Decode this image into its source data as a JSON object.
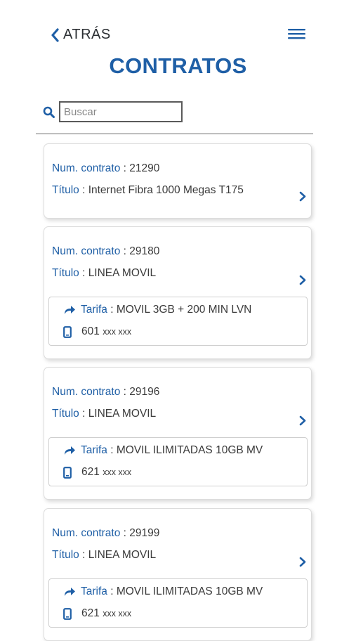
{
  "header": {
    "back_label": "ATRÁS",
    "title": "CONTRATOS"
  },
  "search": {
    "placeholder": "Buscar",
    "value": ""
  },
  "labels": {
    "contract_number": "Num. contrato",
    "title": "Título",
    "tariff": "Tarifa"
  },
  "contracts": [
    {
      "number": "21290",
      "title": "Internet Fibra 1000 Megas T175"
    },
    {
      "number": "29180",
      "title": "LINEA MOVIL",
      "tariff": "MOVIL 3GB + 200 MIN LVN",
      "phone_prefix": "601",
      "phone_masked": "xxx xxx"
    },
    {
      "number": "29196",
      "title": "LINEA MOVIL",
      "tariff": "MOVIL ILIMITADAS 10GB MV",
      "phone_prefix": "621",
      "phone_masked": "xxx xxx"
    },
    {
      "number": "29199",
      "title": "LINEA MOVIL",
      "tariff": "MOVIL ILIMITADAS 10GB MV",
      "phone_prefix": "621",
      "phone_masked": "xxx xxx"
    }
  ],
  "colors": {
    "accent": "#1f5fa6",
    "text": "#3a3a3a",
    "border": "#dcdcdc"
  },
  "icons": {
    "back": "chevron-left-icon",
    "menu": "hamburger-menu-icon",
    "search": "search-icon",
    "card_action": "chevron-right-icon",
    "tariff": "share-arrow-icon",
    "phone": "mobile-phone-icon"
  }
}
